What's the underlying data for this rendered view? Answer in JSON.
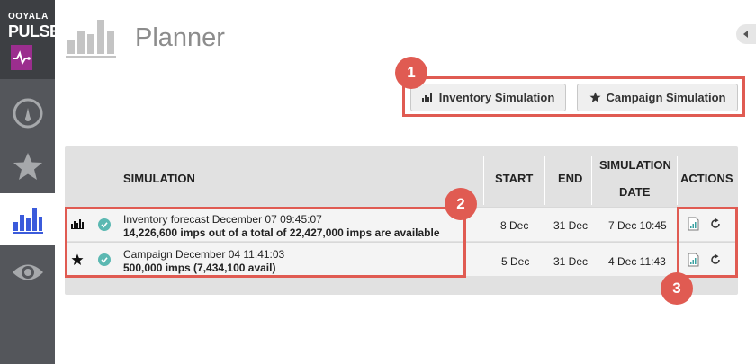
{
  "brand": {
    "small": "OOYALA",
    "big": "PULSE"
  },
  "page": {
    "title": "Planner"
  },
  "buttons": {
    "inventory": "Inventory Simulation",
    "campaign": "Campaign Simulation"
  },
  "callouts": [
    "1",
    "2",
    "3"
  ],
  "table": {
    "headers": {
      "simulation": "SIMULATION",
      "start": "START",
      "end": "END",
      "simdate_line1": "SIMULATION",
      "simdate_line2": "DATE",
      "actions": "ACTIONS"
    },
    "rows": [
      {
        "type_icon": "bar-chart-icon",
        "title": "Inventory forecast December 07 09:45:07",
        "summary": "14,226,600 imps out of a total of 22,427,000 imps are available",
        "start": "8 Dec",
        "end": "31 Dec",
        "sim_date": "7 Dec 10:45"
      },
      {
        "type_icon": "star-icon",
        "title": "Campaign December 04 11:41:03",
        "summary": "500,000 imps (7,434,100 avail)",
        "start": "5 Dec",
        "end": "31 Dec",
        "sim_date": "4 Dec 11:43"
      }
    ]
  },
  "colors": {
    "sidebar": "#54565b",
    "accent_blue": "#3b5bdb",
    "highlight_red": "#e05b52",
    "status_teal": "#5bb8b2",
    "brand_purple": "#9b2e8e"
  }
}
